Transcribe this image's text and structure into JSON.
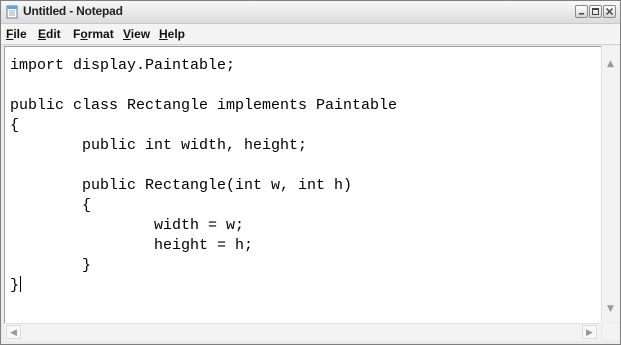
{
  "window": {
    "title": "Untitled - Notepad"
  },
  "menu": {
    "file": {
      "accel": "F",
      "rest": "ile"
    },
    "edit": {
      "accel": "E",
      "rest": "dit"
    },
    "format": {
      "pre": "F",
      "accel": "o",
      "rest": "rmat"
    },
    "view": {
      "accel": "V",
      "rest": "iew"
    },
    "help": {
      "accel": "H",
      "rest": "elp"
    }
  },
  "editor": {
    "lines": [
      "import display.Paintable;",
      "",
      "public class Rectangle implements Paintable",
      "{",
      "        public int width, height;",
      "",
      "        public Rectangle(int w, int h)",
      "        {",
      "                width = w;",
      "                height = h;",
      "        }",
      "}"
    ]
  },
  "icons": {
    "app": "notepad-icon",
    "minimize": "minimize-icon",
    "maximize": "maximize-icon",
    "close": "close-icon",
    "scroll_up": "arrow-up-icon",
    "scroll_down": "arrow-down-icon",
    "scroll_left": "arrow-left-icon",
    "scroll_right": "arrow-right-icon"
  }
}
